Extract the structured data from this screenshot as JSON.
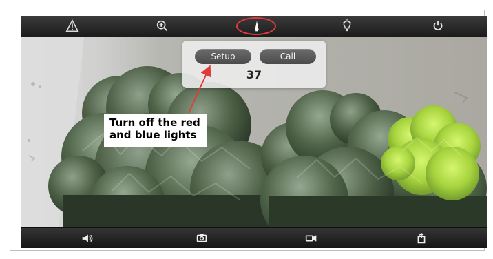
{
  "popup": {
    "setup_label": "Setup",
    "call_label": "Call",
    "count": "37"
  },
  "annotation": {
    "text": "Turn off the red\nand blue lights"
  },
  "icons": {
    "top": [
      "warning-icon",
      "zoom-icon",
      "beacon-icon",
      "light-icon",
      "power-icon"
    ],
    "bottom": [
      "speaker-icon",
      "snapshot-icon",
      "record-icon",
      "share-icon"
    ]
  },
  "colors": {
    "accent": "#e23a3a",
    "toolbar": "#252525",
    "popup_button": "#5a5a5a"
  }
}
